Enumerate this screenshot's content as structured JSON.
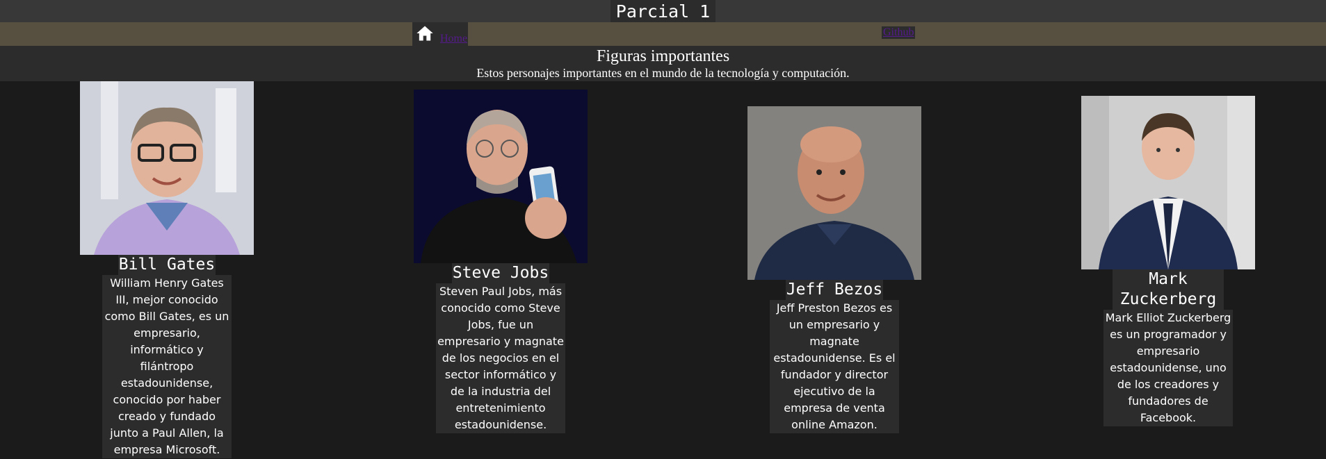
{
  "page": {
    "title": "Parcial 1"
  },
  "nav": {
    "home_icon": "home-icon",
    "home_label": "Home",
    "github_label": "Github"
  },
  "header": {
    "title": "Figuras importantes",
    "subtitle": "Estos personajes importantes en el mundo de la tecnología y computación."
  },
  "people": [
    {
      "name": "Bill Gates",
      "description": "William Henry Gates III, mejor conocido como Bill Gates, es un empresario, informático y filántropo estadounidense, conocido por haber creado y fundado junto a Paul Allen, la empresa Microsoft.",
      "photo": "portrait-photo"
    },
    {
      "name": "Steve Jobs",
      "description": "Steven Paul Jobs, más conocido como Steve Jobs, fue un empresario y magnate de los negocios en el sector informático y de la industria del entretenimiento estadounidense.",
      "photo": "portrait-photo"
    },
    {
      "name": "Jeff Bezos",
      "description": "Jeff Preston Bezos es un empresario y magnate estadounidense. Es el fundador y director ejecutivo de la empresa de venta online Amazon.",
      "photo": "portrait-photo"
    },
    {
      "name": "Mark Zuckerberg",
      "description": "Mark Elliot Zuckerberg es un programador y empresario estadounidense, uno de los creadores y fundadores de Facebook.",
      "photo": "portrait-photo"
    }
  ],
  "colors": {
    "background": "#1b1b1b",
    "block": "#2c2c2c",
    "nav": "#575040",
    "link": "#551a8b"
  }
}
